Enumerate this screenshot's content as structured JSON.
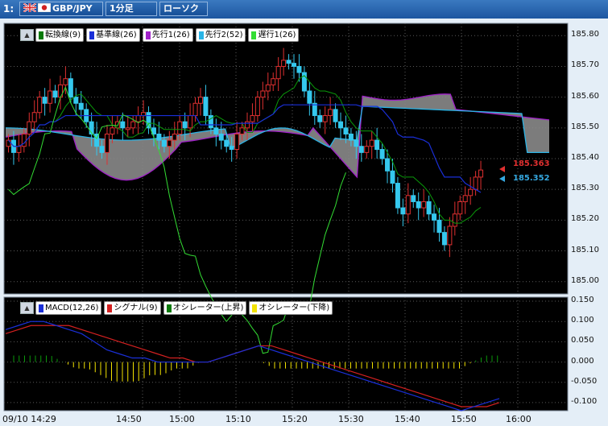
{
  "toolbar": {
    "index": "1:",
    "pair": "GBP/JPY",
    "timeframe": "1分足",
    "chart_type": "ローソク",
    "pair_flags": [
      "uk-flag-icon",
      "japan-flag-icon"
    ]
  },
  "main": {
    "legend": [
      {
        "label": "転換線(9)",
        "color": "#0a7a0a"
      },
      {
        "label": "基準線(26)",
        "color": "#1a2fd8"
      },
      {
        "label": "先行1(26)",
        "color": "#a020c8"
      },
      {
        "label": "先行2(52)",
        "color": "#2ab4e6"
      },
      {
        "label": "遅行1(26)",
        "color": "#33dd33"
      }
    ],
    "y_ticks": [
      "185.80",
      "185.70",
      "185.60",
      "185.50",
      "185.40",
      "185.30",
      "185.20",
      "185.10",
      "185.00"
    ],
    "price_high_label": "185.363",
    "price_low_label": "185.352"
  },
  "macd": {
    "legend": [
      {
        "label": "MACD(12,26)",
        "color": "#1a2fd8"
      },
      {
        "label": "シグナル(9)",
        "color": "#d42020"
      },
      {
        "label": "オシレーター(上昇)",
        "color": "#0a7a0a"
      },
      {
        "label": "オシレーター(下降)",
        "color": "#f2e200"
      }
    ],
    "y_ticks": [
      "0.150",
      "0.100",
      "0.050",
      "0.000",
      "-0.050",
      "-0.100"
    ]
  },
  "x_axis": {
    "start_label": "09/10 14:29",
    "ticks": [
      "14:50",
      "15:00",
      "15:10",
      "15:20",
      "15:30",
      "15:40",
      "15:50",
      "16:00"
    ]
  },
  "colors": {
    "bull_candle": "#e03030",
    "bear_candle": "#35c8ee",
    "background": "#000000",
    "cloud": "#8a8a8a"
  },
  "chart_data": [
    {
      "type": "candlestick",
      "title": "GBP/JPY 1分足",
      "ylim": [
        184.96,
        185.84
      ],
      "x_range": [
        "14:29",
        "16:00"
      ],
      "ohlc_approx_close": [
        185.46,
        185.42,
        185.44,
        185.48,
        185.52,
        185.55,
        185.6,
        185.58,
        185.62,
        185.6,
        185.64,
        185.66,
        185.6,
        185.58,
        185.56,
        185.52,
        185.48,
        185.44,
        185.42,
        185.48,
        185.5,
        185.52,
        185.5,
        185.5,
        185.52,
        185.54,
        185.55,
        185.5,
        185.48,
        185.46,
        185.44,
        185.46,
        185.48,
        185.52,
        185.5,
        185.54,
        185.58,
        185.6,
        185.54,
        185.5,
        185.48,
        185.46,
        185.44,
        185.43,
        185.48,
        185.5,
        185.52,
        185.54,
        185.6,
        185.62,
        185.64,
        185.66,
        185.7,
        185.72,
        185.71,
        185.7,
        185.68,
        185.62,
        185.58,
        185.54,
        185.52,
        185.54,
        185.56,
        185.52,
        185.5,
        185.48,
        185.46,
        185.44,
        185.42,
        185.44,
        185.46,
        185.43,
        185.4,
        185.36,
        185.32,
        185.24,
        185.22,
        185.28,
        185.26,
        185.24,
        185.26,
        185.22,
        185.2,
        185.16,
        185.12,
        185.18,
        185.22,
        185.26,
        185.28,
        185.3,
        185.34,
        185.363
      ],
      "last_price_markers": [
        185.363,
        185.352
      ]
    },
    {
      "type": "line",
      "title": "MACD",
      "ylim": [
        -0.12,
        0.16
      ],
      "series": [
        {
          "name": "MACD(12,26)",
          "values": [
            0.08,
            0.09,
            0.1,
            0.1,
            0.09,
            0.08,
            0.07,
            0.05,
            0.03,
            0.02,
            0.01,
            0.01,
            0.0,
            0.0,
            -0.0,
            0.0,
            0.0,
            0.01,
            0.02,
            0.03,
            0.04,
            0.03,
            0.02,
            0.01,
            0.0,
            -0.01,
            -0.02,
            -0.03,
            -0.04,
            -0.05,
            -0.06,
            -0.07,
            -0.08,
            -0.09,
            -0.1,
            -0.11,
            -0.12,
            -0.11,
            -0.1,
            -0.09
          ]
        },
        {
          "name": "シグナル(9)",
          "values": [
            0.07,
            0.08,
            0.09,
            0.09,
            0.09,
            0.09,
            0.08,
            0.07,
            0.06,
            0.05,
            0.04,
            0.03,
            0.02,
            0.01,
            0.01,
            0.0,
            0.0,
            0.01,
            0.02,
            0.03,
            0.04,
            0.04,
            0.03,
            0.02,
            0.01,
            0.0,
            -0.01,
            -0.02,
            -0.03,
            -0.04,
            -0.05,
            -0.06,
            -0.07,
            -0.08,
            -0.09,
            -0.1,
            -0.11,
            -0.11,
            -0.11,
            -0.1
          ]
        }
      ]
    }
  ]
}
